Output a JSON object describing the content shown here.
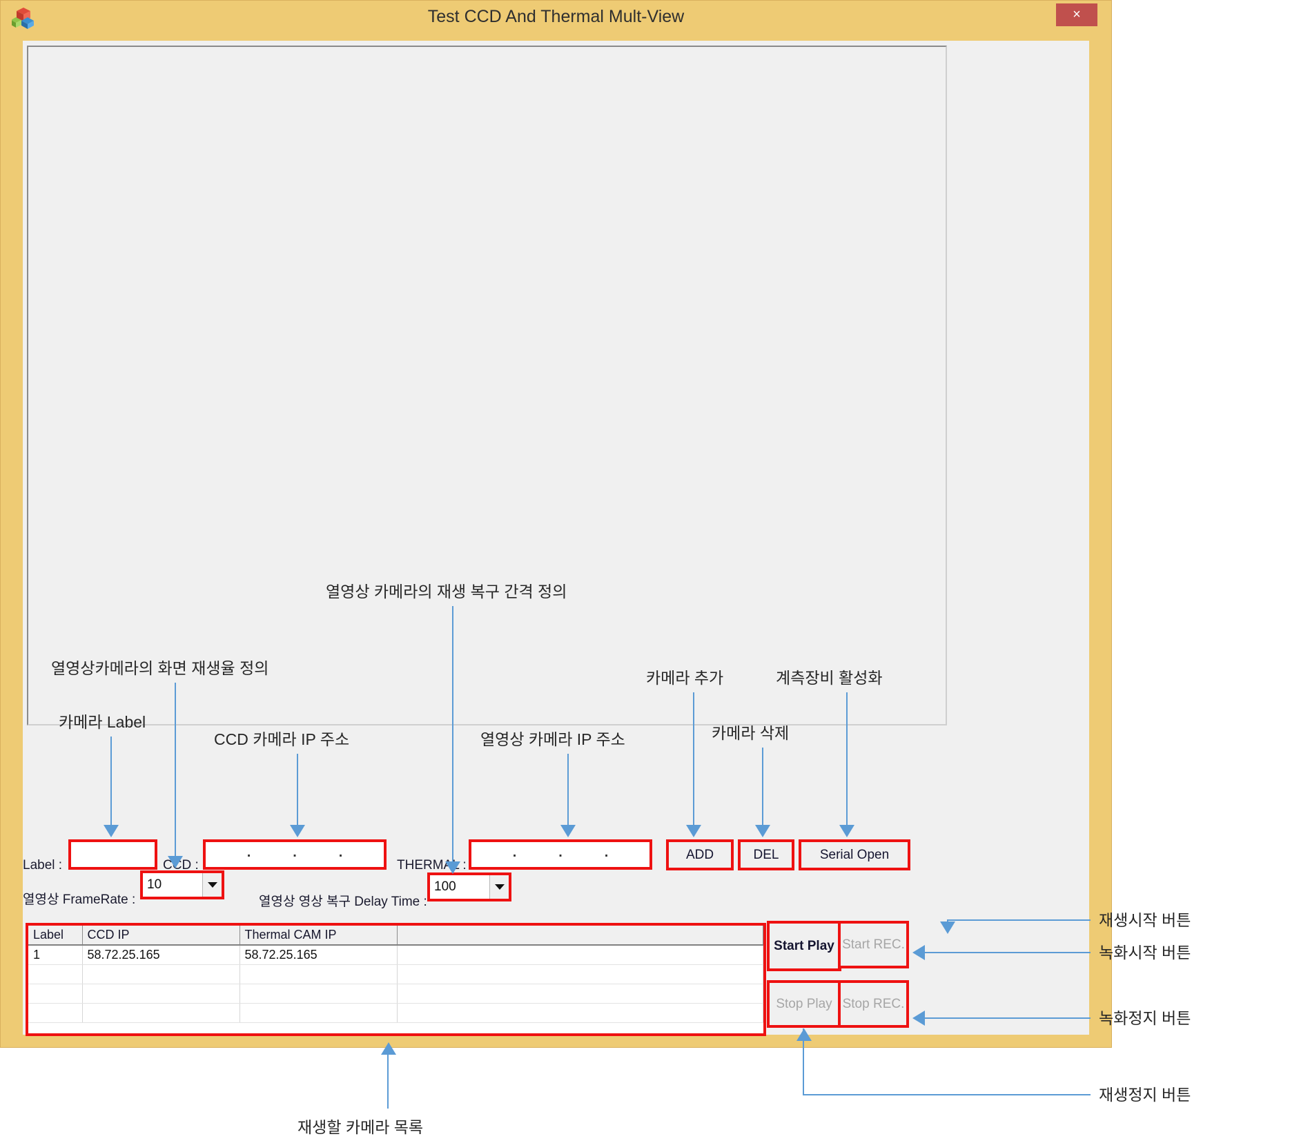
{
  "window": {
    "title": "Test CCD And Thermal Mult-View",
    "icon": "app-cubes-icon",
    "close_label": "×",
    "frame_color": "#eecb74",
    "close_color": "#c0504d"
  },
  "form": {
    "label_label": "Label :",
    "label_value": "",
    "ccd_label": "CCD :",
    "ccd_ip": [
      "",
      "",
      "",
      ""
    ],
    "thermal_label": "THERMAL :",
    "thermal_ip": [
      "",
      "",
      "",
      ""
    ],
    "add_label": "ADD",
    "del_label": "DEL",
    "serial_open_label": "Serial Open",
    "framerate_label": "열영상 FrameRate :",
    "framerate_value": "10",
    "delay_label": "열영상 영상 복구 Delay Time :",
    "delay_value": "100",
    "ip_separator": "."
  },
  "grid": {
    "columns": [
      "Label",
      "CCD IP",
      "Thermal CAM IP",
      ""
    ],
    "rows": [
      [
        "1",
        "58.72.25.165",
        "58.72.25.165",
        ""
      ],
      [
        "",
        "",
        "",
        ""
      ],
      [
        "",
        "",
        "",
        ""
      ],
      [
        "",
        "",
        "",
        ""
      ]
    ]
  },
  "playback": {
    "start_play": "Start Play",
    "start_rec": "Start REC.",
    "stop_play": "Stop Play",
    "stop_rec": "Stop REC."
  },
  "annotations": {
    "thermal_delay": "열영상 카메라의 재생 복구 간격 정의",
    "framerate": "열영상카메라의 화면 재생율 정의",
    "camera_label": "카메라 Label",
    "ccd_ip": "CCD 카메라 IP 주소",
    "thermal_ip": "열영상 카메라 IP 주소",
    "camera_add": "카메라 추가",
    "camera_del": "카메라 삭제",
    "serial_enable": "계측장비 활성화",
    "start_play": "재생시작 버튼",
    "start_rec": "녹화시작 버튼",
    "stop_rec": "녹화정지 버튼",
    "stop_play": "재생정지 버튼",
    "camera_list": "재생할 카메라 목록"
  }
}
